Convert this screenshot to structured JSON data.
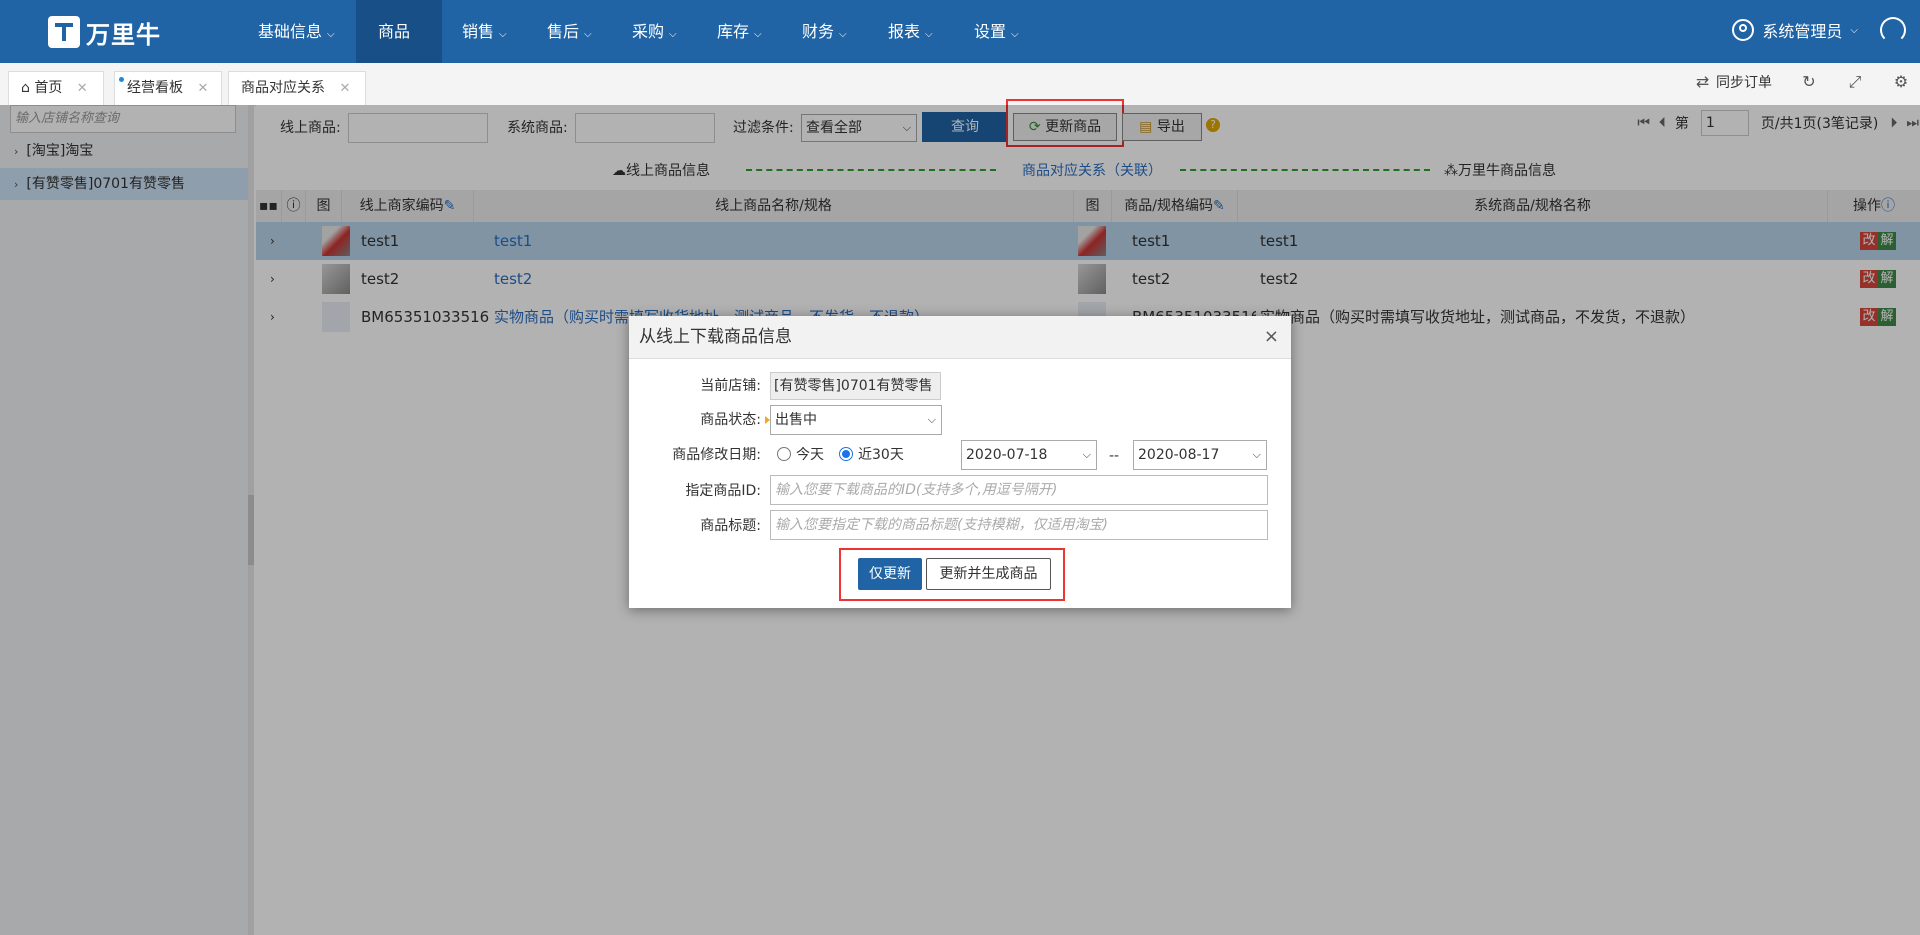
{
  "brand": {
    "logo_text": "万里牛"
  },
  "topnav": {
    "items": [
      {
        "label": "基础信息"
      },
      {
        "label": "商品"
      },
      {
        "label": "销售"
      },
      {
        "label": "售后"
      },
      {
        "label": "采购"
      },
      {
        "label": "库存"
      },
      {
        "label": "财务"
      },
      {
        "label": "报表"
      },
      {
        "label": "设置"
      }
    ],
    "active_index": 1,
    "user_label": "系统管理员"
  },
  "tabs": [
    {
      "label": "首页"
    },
    {
      "label": "经营看板"
    },
    {
      "label": "商品对应关系"
    }
  ],
  "tools": {
    "sync_orders": "同步订单"
  },
  "sidebar": {
    "search_placeholder": "输入店铺名称查询",
    "items": [
      {
        "label": "[淘宝]淘宝"
      },
      {
        "label": "[有赞零售]0701有赞零售"
      }
    ]
  },
  "toolbar": {
    "online_label": "线上商品:",
    "system_label": "系统商品:",
    "filter_label": "过滤条件:",
    "filter_value": "查看全部",
    "query_button": "查询",
    "update_button": "更新商品",
    "export_button": "导出"
  },
  "pager": {
    "prefix": "第",
    "page": "1",
    "suffix": "页/共1页(3笔记录)"
  },
  "legend": {
    "online_info": "线上商品信息",
    "relation": "商品对应关系（关联）",
    "system_info": "万里牛商品信息"
  },
  "grid": {
    "headers": {
      "img1": "图",
      "merchant_code": "线上商家编码",
      "online_name": "线上商品名称/规格",
      "img2": "图",
      "sku_code": "商品/规格编码",
      "system_name": "系统商品/规格名称",
      "actions": "操作"
    },
    "rows": [
      {
        "code": "test1",
        "name": "test1",
        "sku": "test1",
        "sys_name": "test1",
        "edit": "改",
        "unlink": "解"
      },
      {
        "code": "test2",
        "name": "test2",
        "sku": "test2",
        "sys_name": "test2",
        "edit": "改",
        "unlink": "解"
      },
      {
        "code": "BM65351033516",
        "name": "实物商品（购买时需填写收货地址，测试商品，不发货，不退款）",
        "sku": "BM65351033516",
        "sys_name": "实物商品（购买时需填写收货地址，测试商品，不发货，不退款）",
        "edit": "改",
        "unlink": "解"
      }
    ]
  },
  "modal": {
    "title": "从线上下载商品信息",
    "close": "×",
    "shop_label": "当前店铺:",
    "shop_value": "[有赞零售]0701有赞零售",
    "status_label": "商品状态:",
    "status_value": "出售中",
    "date_label": "商品修改日期:",
    "radio_today": "今天",
    "radio_30days": "近30天",
    "date_from": "2020-07-18",
    "date_sep": "--",
    "date_to": "2020-08-17",
    "id_label": "指定商品ID:",
    "id_placeholder": "输入您要下载商品的ID(支持多个,用逗号隔开)",
    "title_label": "商品标题:",
    "title_placeholder": "输入您要指定下载的商品标题(支持模糊，仅适用淘宝)",
    "btn_update_only": "仅更新",
    "btn_update_generate": "更新并生成商品"
  },
  "colors": {
    "nav_bg": "#2064a6",
    "nav_active": "#174f86",
    "highlight_box": "#e33333",
    "link": "#2a6fc4",
    "action_edit": "#d9463c",
    "action_unlink": "#3f8a4a"
  }
}
